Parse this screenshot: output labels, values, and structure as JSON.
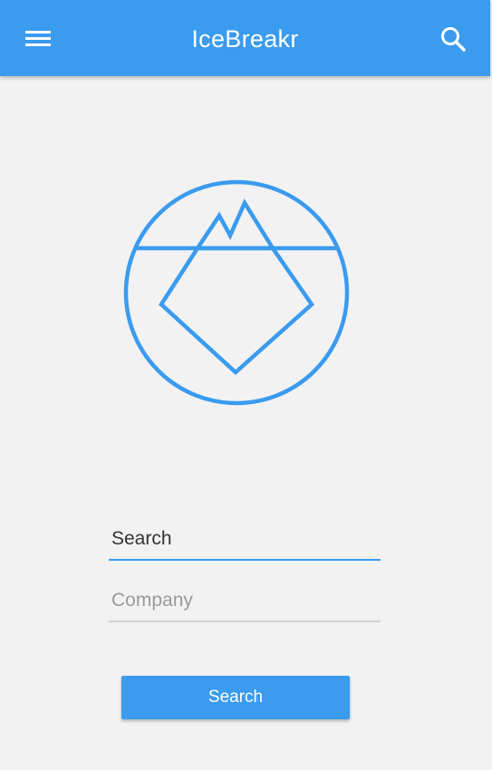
{
  "app_bar": {
    "title": "IceBreakr",
    "menu_icon": "hamburger-menu-icon",
    "search_icon": "search-icon",
    "background_color": "#3a9bef"
  },
  "logo": {
    "icon": "iceberg-logo-icon",
    "color": "#3a9bef"
  },
  "form": {
    "search_field": {
      "placeholder": "Search",
      "value": ""
    },
    "company_field": {
      "placeholder": "Company",
      "value": ""
    },
    "submit_label": "Search"
  },
  "colors": {
    "accent": "#3a9bef",
    "background": "#f2f2f2",
    "inactive_underline": "#d0d0d0"
  }
}
